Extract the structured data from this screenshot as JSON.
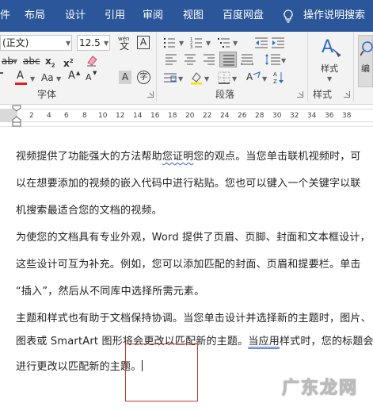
{
  "tabs": [
    {
      "label": "件"
    },
    {
      "label": "布局"
    },
    {
      "label": "设计"
    },
    {
      "label": "引用"
    },
    {
      "label": "审阅"
    },
    {
      "label": "视图"
    },
    {
      "label": "百度网盘"
    },
    {
      "label": "操作说明搜索"
    }
  ],
  "font": {
    "name_value": "(正文)",
    "size_value": "12.5",
    "phonetic_top": "wén",
    "phonetic_char": "文",
    "border_char": "A",
    "format_b": "ab",
    "strike_label": "abc",
    "sub_label": "x",
    "sup_label": "x",
    "sub_mark": "2",
    "sup_mark": "2",
    "color_a": "A",
    "case_label": "Aa",
    "grow_a": "A",
    "shrink_a": "A",
    "shade_a": "A",
    "circle_char": "字",
    "group_label": "字体"
  },
  "paragraph": {
    "group_label": "段落"
  },
  "styles": {
    "button_label": "样式",
    "group_label": "样式",
    "edit_label": "编"
  },
  "ruler": {
    "ticks": [
      "2",
      "4",
      "6",
      "8",
      "10",
      "12",
      "14",
      "16",
      "18",
      "20",
      "22",
      "24",
      "26",
      "28",
      "30",
      "32",
      "34",
      "36",
      "38"
    ]
  },
  "document": {
    "lines": [
      {
        "pre": "视频提供了功能强大的方法帮助",
        "mark": "您证明",
        "post": "您的观点。当您单击联机视频时，可"
      },
      {
        "text": "以在想要添加的视频的嵌入代码中进行粘贴。您也可以键入一个关键字以联"
      },
      {
        "text": "机搜索最适合您的文档的视频。"
      },
      {
        "text": "为使您的文档具有专业外观，Word 提供了页眉、页脚、封面和文本框设计，"
      },
      {
        "text": "这些设计可互为补充。例如，您可以添加匹配的封面、页眉和提要栏。单击"
      },
      {
        "text": "“插入”，然后从不同库中选择所需元素。"
      },
      {
        "text": "主题和样式也有助于文档保持协调。当您单击设计并选择新的主题时，图片、"
      },
      {
        "pre": "图表或 SmartArt 图形将会更改以匹配新的主题。",
        "mark": "当应用",
        "post": "样式时，您的标题会"
      },
      {
        "text": "进行更改以匹配新的主题。"
      }
    ]
  },
  "watermark": {
    "text": "广东龙网"
  },
  "colors": {
    "ribbon_tab_bg": "#2b579a",
    "font_color_red": "#e02020",
    "highlight_yellow": "#f5e400",
    "selection_box": "#c0392b",
    "proofing_underline": "#2f62c8"
  }
}
